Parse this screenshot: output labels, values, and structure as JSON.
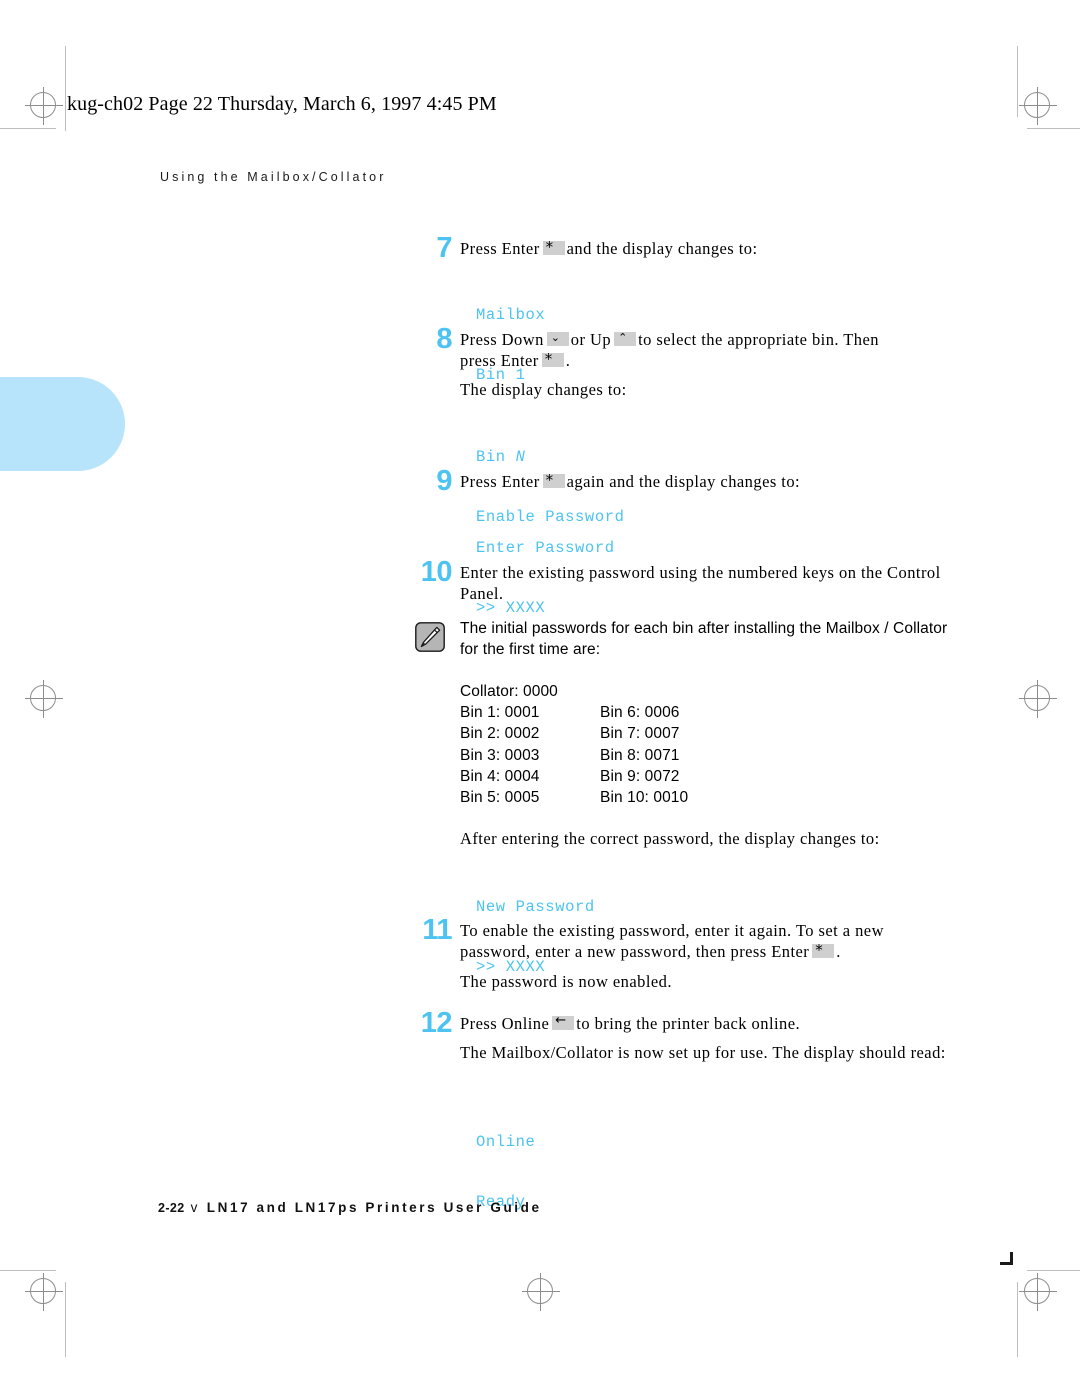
{
  "page": {
    "header_line": "kug-ch02  Page 22  Thursday, March 6, 1997  4:45 PM",
    "running_head": "Using the Mailbox/Collator",
    "footer_page": "2-22",
    "footer_separator": "v",
    "footer_title": "LN17 and LN17ps Printers User Guide"
  },
  "colors": {
    "display_cyan": "#4cc3f0",
    "step_number_cyan": "#4cc3f0",
    "thumb_tab_blue": "#b7e4fa",
    "key_gray": "#cfcfcf",
    "registration_gray": "#8d8d8d"
  },
  "keys": {
    "enter": "*",
    "down": "⌄",
    "up": "⌃",
    "online": "←"
  },
  "steps": [
    {
      "number": "7",
      "text_before": "Press Enter",
      "key": "enter",
      "text_after": "and the display changes to:",
      "display": [
        "Mailbox",
        "Bin 1"
      ]
    },
    {
      "number": "8",
      "line1_a": "Press Down",
      "key1": "down",
      "line1_b": "or Up",
      "key2": "up",
      "line1_c": "to select the appropriate bin. Then",
      "line2_a": "press Enter",
      "key3": "enter",
      "line2_b": ".",
      "follow_paragraph": "The display changes to:",
      "display": [
        "Bin N",
        "Enable Password"
      ],
      "display_italic_token": "N"
    },
    {
      "number": "9",
      "text_before": "Press Enter",
      "key": "enter",
      "text_after": "again and the display changes to:",
      "display": [
        "Enter Password",
        ">> XXXX"
      ]
    },
    {
      "number": "10",
      "text": "Enter the existing password using the numbered keys on the Control Panel."
    },
    {
      "number": "11",
      "line1": "To enable the existing password, enter it again. To set a new",
      "line2_a": "password, enter a new password, then press Enter",
      "key": "enter",
      "line2_b": ".",
      "follow_paragraph": "The password is now enabled."
    },
    {
      "number": "12",
      "text_before": "Press Online",
      "key": "online",
      "text_after": "to bring the printer back online.",
      "follow_paragraph": "The Mailbox/Collator is now set up for use. The display should read:",
      "display": [
        "Online",
        "Ready"
      ]
    }
  ],
  "note": {
    "icon": "pencil-note-icon",
    "text": "The initial passwords for each bin after installing the Mailbox / Collator for the first time are:"
  },
  "password_table": {
    "collator": "Collator: 0000",
    "rows": [
      {
        "left": "Bin 1: 0001",
        "right": "Bin 6: 0006"
      },
      {
        "left": "Bin 2: 0002",
        "right": "Bin 7: 0007"
      },
      {
        "left": "Bin 3: 0003",
        "right": "Bin 8: 0071"
      },
      {
        "left": "Bin 4: 0004",
        "right": "Bin 9: 0072"
      },
      {
        "left": "Bin 5: 0005",
        "right": "Bin 10: 0010"
      }
    ]
  },
  "after_password_paragraph": "After entering the correct password, the display changes to:",
  "after_password_display": [
    "New Password",
    ">> XXXX"
  ]
}
